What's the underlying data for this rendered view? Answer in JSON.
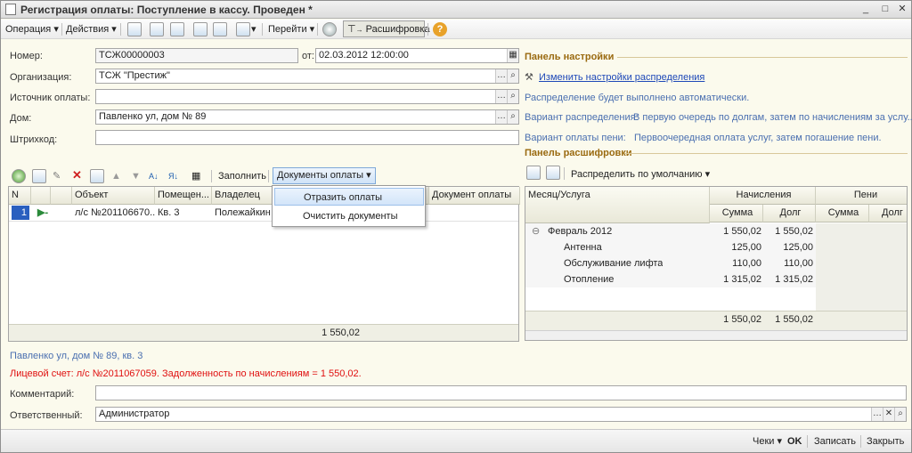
{
  "window": {
    "title": "Регистрация оплаты: Поступление в кассу. Проведен *",
    "controls": [
      "_",
      "□",
      "✕"
    ]
  },
  "toolbar": {
    "operation": "Операция",
    "actions": "Действия",
    "goto": "Перейти",
    "decode": "Расшифровка",
    "help": "?"
  },
  "form": {
    "number_label": "Номер:",
    "number_value": "ТСЖ00000003",
    "date_label": "от:",
    "date_value": "02.03.2012 12:00:00",
    "org_label": "Организация:",
    "org_value": "ТСЖ \"Престиж\"",
    "source_label": "Источник оплаты:",
    "source_value": "",
    "house_label": "Дом:",
    "house_value": "Павленко ул, дом № 89",
    "barcode_label": "Штрихкод:",
    "barcode_value": ""
  },
  "settings_panel": {
    "title": "Панель настройки",
    "change_link": "Изменить настройки распределения",
    "auto_text": "Распределение будет выполнено автоматически.",
    "variant_label": "Вариант распределения:",
    "variant_value": "В первую очередь по долгам, затем по начислениям за услу...",
    "penalty_label": "Вариант оплаты пени:",
    "penalty_value": "Первоочередная оплата услуг, затем погашение пени."
  },
  "grid_toolbar": {
    "fill": "Заполнить",
    "docs": "Документы оплаты"
  },
  "dropdown": {
    "items": [
      "Отразить оплаты",
      "Очистить документы"
    ]
  },
  "main_table": {
    "headers": [
      "N",
      "Объект",
      "Помещен...",
      "Владелец",
      "Документ оплаты"
    ],
    "rows": [
      {
        "n": "1",
        "object": "л/с №201106670...",
        "room": "Кв. 3",
        "owner": "Полежайкин Е"
      }
    ],
    "footer_total": "1 550,02"
  },
  "decode_panel": {
    "title": "Панель расшифровки",
    "distribute": "Распределить по умолчанию",
    "col_month": "Месяц/Услуга",
    "col_accr": "Начисления",
    "col_pen": "Пени",
    "sub_sum": "Сумма",
    "sub_debt": "Долг",
    "rows": [
      {
        "name": "Февраль 2012",
        "sum": "1 550,02",
        "debt": "1 550,02",
        "group": true
      },
      {
        "name": "Антенна",
        "sum": "125,00",
        "debt": "125,00",
        "group": false
      },
      {
        "name": "Обслуживание лифта",
        "sum": "110,00",
        "debt": "110,00",
        "group": false
      },
      {
        "name": "Отопление",
        "sum": "1 315,02",
        "debt": "1 315,02",
        "group": false
      }
    ],
    "total_sum": "1 550,02",
    "total_debt": "1 550,02"
  },
  "info": {
    "address": "Павленко ул, дом № 89, кв. 3",
    "account": "Лицевой счет: л/с №2011067059. Задолженность по начислениям = 1 550,02."
  },
  "comment": {
    "label": "Комментарий:",
    "value": ""
  },
  "responsible": {
    "label": "Ответственный:",
    "value": "Администратор"
  },
  "bottom": {
    "checks": "Чеки",
    "ok": "OK",
    "save": "Записать",
    "close": "Закрыть"
  },
  "colors": {
    "section": "#9a6a10",
    "link": "#1f49b8",
    "info": "#4a6fb0",
    "error": "#e01010"
  }
}
